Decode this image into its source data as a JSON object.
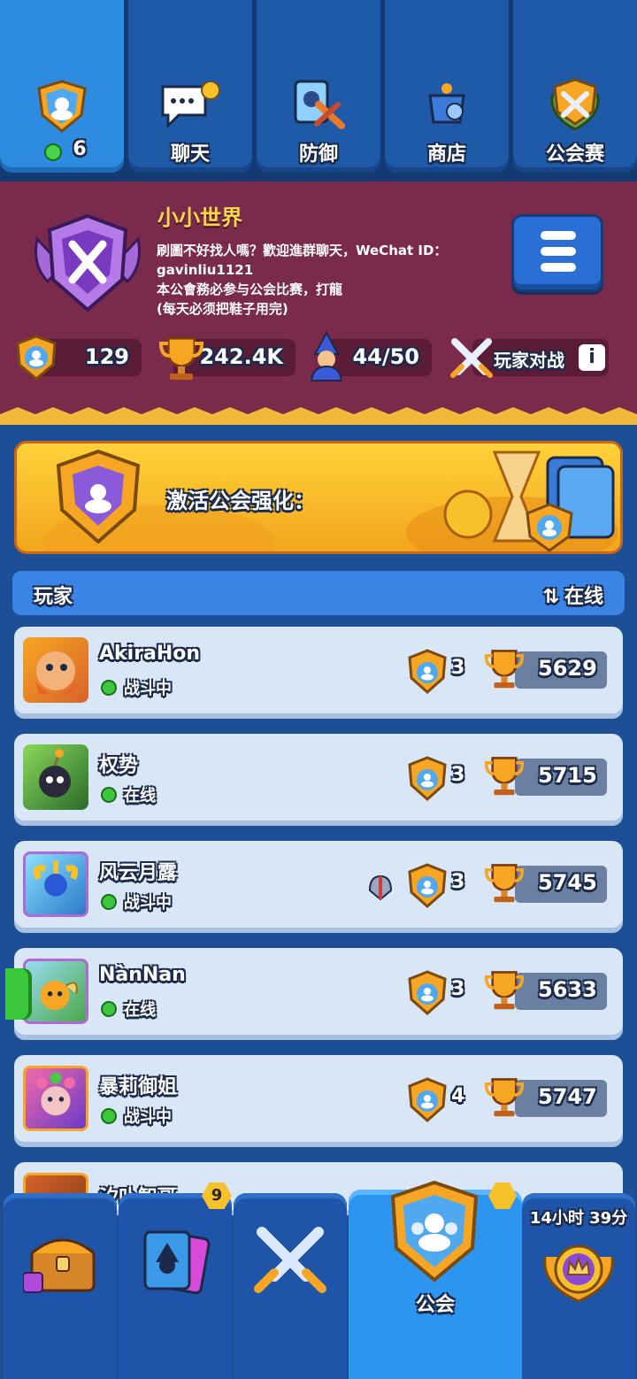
{
  "top_tabs": [
    {
      "label": "6",
      "icon": "clan-shield-icon",
      "online_dot": "#4bd44b"
    },
    {
      "label": "聊天",
      "icon": "chat-icon"
    },
    {
      "label": "防御",
      "icon": "defense-icon"
    },
    {
      "label": "商店",
      "icon": "shop-icon"
    },
    {
      "label": "公会赛",
      "icon": "clan-war-icon"
    }
  ],
  "clan": {
    "name": "小小世界",
    "description": "刷圖不好找人嗎？歡迎進群聊天，WeChat ID：\ngavinliu1121\n本公會務必参与公会比赛，打龍\n(每天必须把鞋子用完)",
    "stats": {
      "level": "129",
      "trophies": "242.4K",
      "members": "44/50",
      "mode": "玩家对战"
    }
  },
  "boost": {
    "label": "激活公会强化："
  },
  "players_header": {
    "title": "玩家",
    "sort": "在线"
  },
  "players": [
    {
      "name": "AkiraHon",
      "status": "战斗中",
      "level": "3",
      "trophies": "5629",
      "avatar_color": "#e8822a"
    },
    {
      "name": "权势",
      "status": "在线",
      "level": "3",
      "trophies": "5715",
      "avatar_color": "#4a8a3a"
    },
    {
      "name": "风云月露",
      "status": "战斗中",
      "level": "3",
      "trophies": "5745",
      "avatar_color": "#3aa8d8"
    },
    {
      "name": "NànNan",
      "status": "在线",
      "level": "3",
      "trophies": "5633",
      "avatar_color": "#8ac24a"
    },
    {
      "name": "暴莉御姐",
      "status": "战斗中",
      "level": "4",
      "trophies": "5747",
      "avatar_color": "#c84a8a"
    }
  ],
  "partial_player": {
    "name": "汐卟智哥"
  },
  "bottom_nav": [
    {
      "icon": "chest-icon"
    },
    {
      "icon": "cards-icon",
      "badge": "9"
    },
    {
      "icon": "battle-swords-icon"
    },
    {
      "icon": "clan-icon",
      "label": "公会"
    },
    {
      "icon": "season-crown-icon",
      "timer": "14小时 39分"
    }
  ],
  "colors": {
    "accent_gold": "#ffd84a",
    "clan_panel": "#7a2a4a",
    "row_bg": "#d8e6f6",
    "online_green": "#3cc83c"
  }
}
